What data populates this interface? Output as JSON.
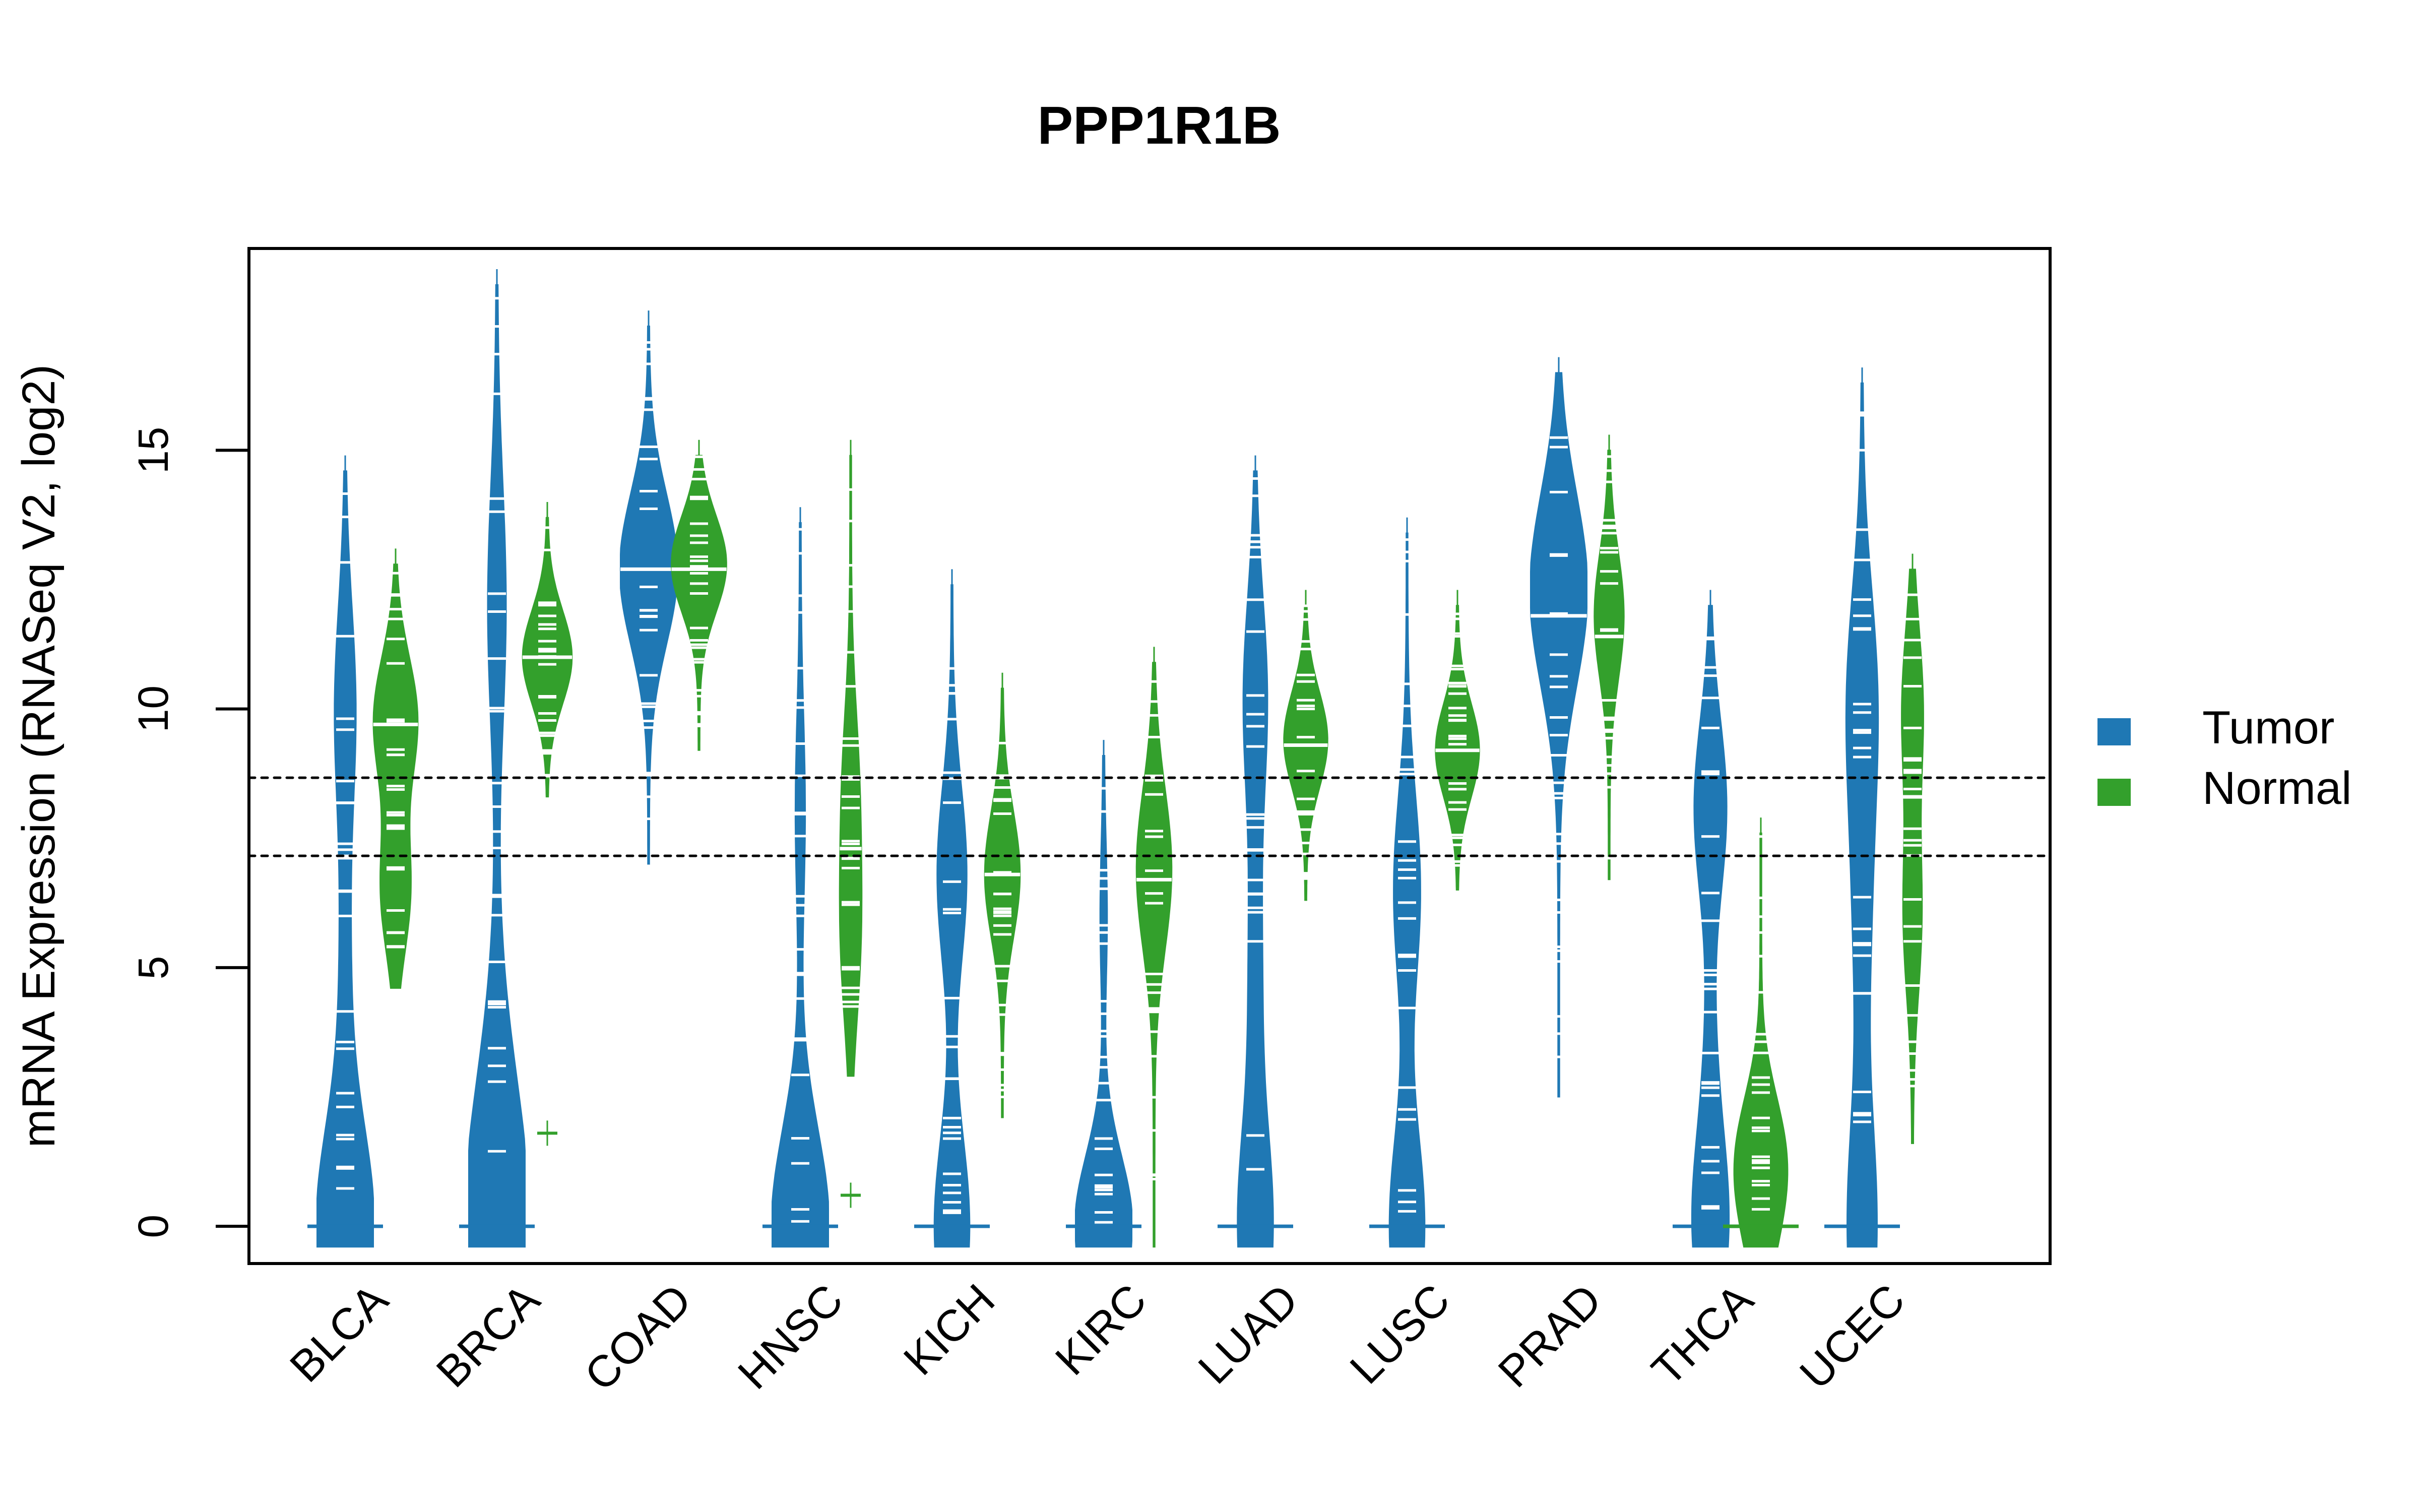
{
  "chart_data": {
    "type": "violin",
    "title": "PPP1R1B",
    "xlabel": "",
    "ylabel": "mRNA Expression (RNASeq V2, log2)",
    "ylim": [
      -0.72,
      18.9
    ],
    "yticks": [
      0,
      5,
      10,
      15
    ],
    "ytick_labels": [
      "0",
      "5",
      "10",
      "15"
    ],
    "grid": false,
    "reference_lines": [
      8.67,
      7.16
    ],
    "categories": [
      "BLCA",
      "BRCA",
      "COAD",
      "HNSC",
      "KICH",
      "KIRC",
      "LUAD",
      "LUSC",
      "PRAD",
      "THCA",
      "UCEC"
    ],
    "legend": {
      "position": "right",
      "entries": [
        {
          "label": "Tumor",
          "color": "#1F78B4"
        },
        {
          "label": "Normal",
          "color": "#33A02C"
        }
      ]
    },
    "series": [
      {
        "name": "Tumor",
        "color": "#1F78B4",
        "groups": [
          {
            "category": "BLCA",
            "min": 0,
            "max": 14.6,
            "median": 0,
            "modes": [
              [
                0,
                1.0
              ],
              [
                10,
                0.35
              ],
              [
                5,
                0.15
              ]
            ]
          },
          {
            "category": "BRCA",
            "min": 0,
            "max": 18.2,
            "median": 0,
            "modes": [
              [
                0,
                1.0
              ],
              [
                12,
                0.3
              ],
              [
                3,
                0.2
              ]
            ]
          },
          {
            "category": "COAD",
            "min": 7.4,
            "max": 17.4,
            "median": 12.7,
            "modes": [
              [
                12.7,
                1.0
              ]
            ]
          },
          {
            "category": "HNSC",
            "min": 0,
            "max": 13.6,
            "median": 0,
            "modes": [
              [
                0,
                1.0
              ],
              [
                8,
                0.15
              ]
            ]
          },
          {
            "category": "KICH",
            "min": 0,
            "max": 12.4,
            "median": 0,
            "modes": [
              [
                0,
                0.6
              ],
              [
                6.8,
                0.5
              ]
            ]
          },
          {
            "category": "KIRC",
            "min": 0,
            "max": 9.1,
            "median": 0,
            "modes": [
              [
                0,
                1.0
              ],
              [
                6,
                0.1
              ]
            ]
          },
          {
            "category": "LUAD",
            "min": 0,
            "max": 14.6,
            "median": 0,
            "modes": [
              [
                0,
                0.6
              ],
              [
                10.2,
                0.4
              ],
              [
                5,
                0.2
              ]
            ]
          },
          {
            "category": "LUSC",
            "min": 0,
            "max": 13.4,
            "median": 0,
            "modes": [
              [
                0,
                0.6
              ],
              [
                6.5,
                0.45
              ]
            ]
          },
          {
            "category": "PRAD",
            "min": 2.9,
            "max": 16.5,
            "median": 11.8,
            "modes": [
              [
                12.3,
                1.0
              ]
            ]
          },
          {
            "category": "THCA",
            "min": 0,
            "max": 12.0,
            "median": 0,
            "modes": [
              [
                0,
                0.6
              ],
              [
                8.1,
                0.55
              ],
              [
                3,
                0.15
              ]
            ]
          },
          {
            "category": "UCEC",
            "min": 0,
            "max": 16.3,
            "median": 0,
            "modes": [
              [
                0,
                0.5
              ],
              [
                10.2,
                0.5
              ],
              [
                6,
                0.25
              ]
            ]
          }
        ]
      },
      {
        "name": "Normal",
        "color": "#33A02C",
        "groups": [
          {
            "category": "BLCA",
            "min": 5.0,
            "max": 12.8,
            "median": 9.7,
            "modes": [
              [
                9.8,
                0.75
              ],
              [
                6.5,
                0.5
              ]
            ]
          },
          {
            "category": "BRCA",
            "min": 8.7,
            "max": 13.7,
            "median": 11.0,
            "modes": [
              [
                11.0,
                0.85
              ]
            ],
            "outliers": [
              1.8
            ]
          },
          {
            "category": "COAD",
            "min": 9.6,
            "max": 14.9,
            "median": 12.7,
            "modes": [
              [
                12.8,
                0.95
              ]
            ]
          },
          {
            "category": "HNSC",
            "min": 3.3,
            "max": 14.9,
            "median": 7.3,
            "modes": [
              [
                5.5,
                0.3
              ],
              [
                8.5,
                0.25
              ]
            ],
            "outliers": [
              0.6
            ]
          },
          {
            "category": "KICH",
            "min": 2.5,
            "max": 10.4,
            "median": 6.8,
            "modes": [
              [
                6.8,
                0.6
              ]
            ]
          },
          {
            "category": "KIRC",
            "min": 0,
            "max": 10.9,
            "median": 6.7,
            "modes": [
              [
                6.9,
                0.6
              ]
            ]
          },
          {
            "category": "LUAD",
            "min": 6.7,
            "max": 12.0,
            "median": 9.3,
            "modes": [
              [
                9.4,
                0.75
              ]
            ]
          },
          {
            "category": "LUSC",
            "min": 6.9,
            "max": 12.0,
            "median": 9.2,
            "modes": [
              [
                9.2,
                0.75
              ]
            ]
          },
          {
            "category": "PRAD",
            "min": 7.1,
            "max": 15.0,
            "median": 11.4,
            "modes": [
              [
                11.8,
                0.5
              ]
            ]
          },
          {
            "category": "THCA",
            "min": 0,
            "max": 7.6,
            "median": 0,
            "modes": [
              [
                1.5,
                0.7
              ],
              [
                0,
                0.4
              ]
            ]
          },
          {
            "category": "UCEC",
            "min": 2.0,
            "max": 12.7,
            "median": 8.3,
            "modes": [
              [
                10,
                0.35
              ],
              [
                6,
                0.3
              ]
            ]
          }
        ]
      }
    ]
  }
}
